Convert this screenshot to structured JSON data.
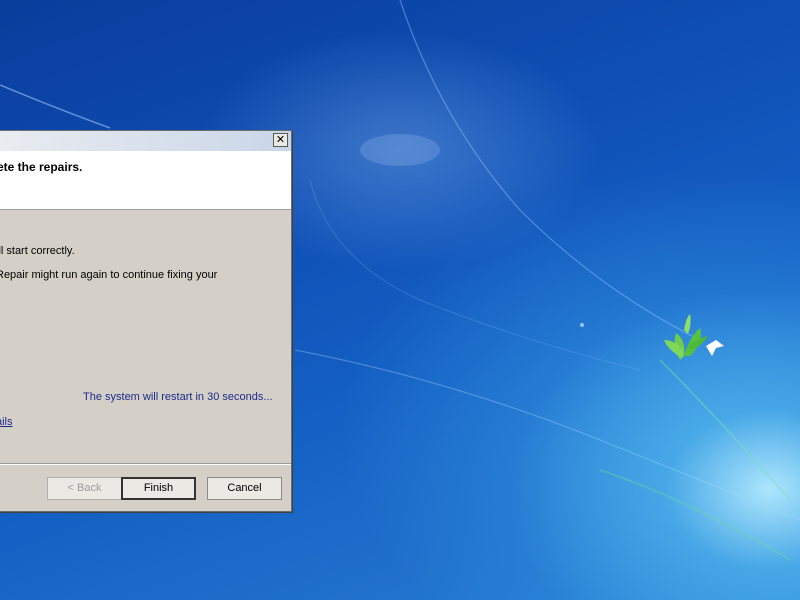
{
  "dialog": {
    "title_bar": {
      "close_glyph": "✕"
    },
    "header": {
      "title": "ete the repairs."
    },
    "body": {
      "line1": "ill start correctly.",
      "line2": "Repair might run again to continue fixing your",
      "restart_notice": "The system will restart in 30 seconds...",
      "details_link": "ails"
    },
    "buttons": {
      "back": "< Back",
      "finish": "Finish",
      "cancel": "Cancel"
    }
  },
  "colors": {
    "desktop_blue": "#0f4fb5",
    "dialog_face": "#d4d0c8",
    "link_blue": "#1c2a8a"
  },
  "icons": {
    "close": "close-icon",
    "wallpaper_logo": "dove-leaf-logo"
  }
}
